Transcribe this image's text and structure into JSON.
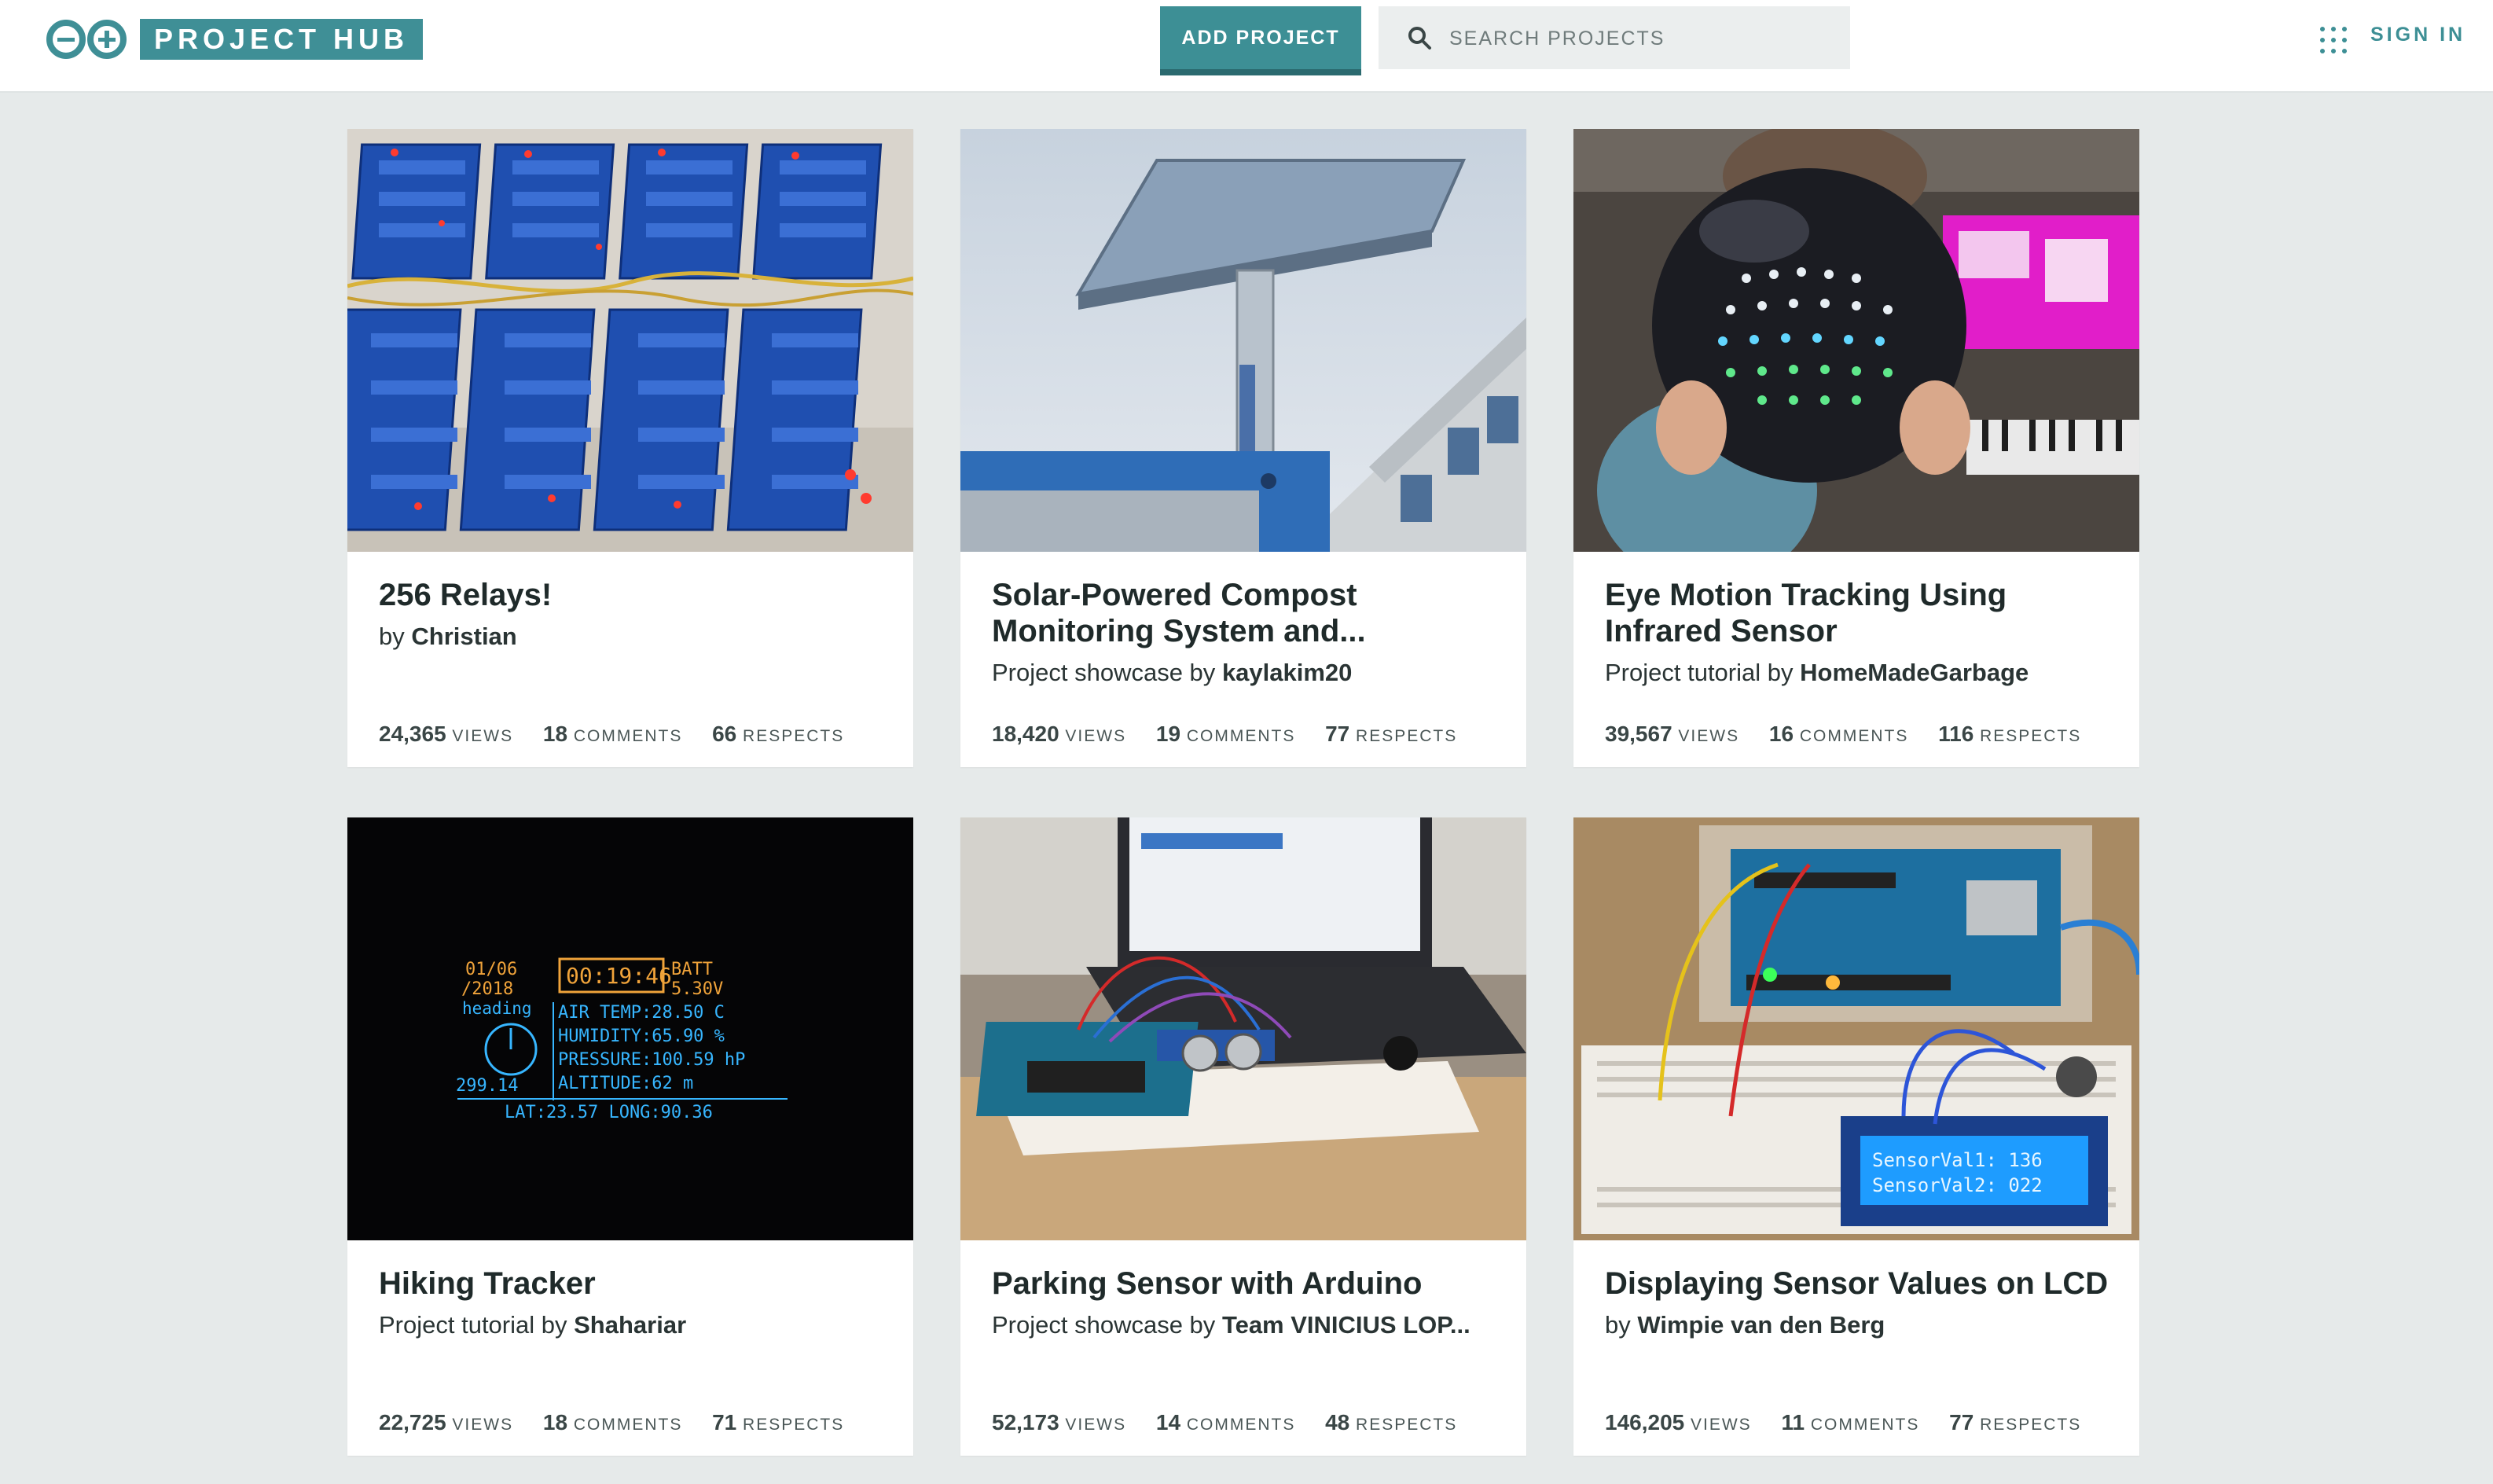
{
  "header": {
    "logo_text": "PROJECT HUB",
    "add_project": "ADD PROJECT",
    "search_placeholder": "SEARCH PROJECTS",
    "sign_in": "SIGN IN"
  },
  "labels": {
    "views": "VIEWS",
    "comments": "COMMENTS",
    "respects": "RESPECTS"
  },
  "colors": {
    "accent": "#3d8f95",
    "background": "#e6eaea"
  },
  "cards": [
    {
      "title": "256 Relays!",
      "prefix": "by",
      "author": "Christian",
      "views": "24,365",
      "comments": "18",
      "respects": "66"
    },
    {
      "title": "Solar-Powered Compost Monitoring System and...",
      "prefix": "Project showcase by",
      "author": "kaylakim20",
      "views": "18,420",
      "comments": "19",
      "respects": "77"
    },
    {
      "title": "Eye Motion Tracking Using Infrared Sensor",
      "prefix": "Project tutorial by",
      "author": "HomeMadeGarbage",
      "views": "39,567",
      "comments": "16",
      "respects": "116"
    },
    {
      "title": "Hiking Tracker",
      "prefix": "Project tutorial by",
      "author": "Shahariar",
      "views": "22,725",
      "comments": "18",
      "respects": "71"
    },
    {
      "title": "Parking Sensor with Arduino",
      "prefix": "Project showcase by",
      "author": "Team VINICIUS LOP...",
      "views": "52,173",
      "comments": "14",
      "respects": "48"
    },
    {
      "title": "Displaying Sensor Values on LCD",
      "prefix": "by",
      "author": "Wimpie van den Berg",
      "views": "146,205",
      "comments": "11",
      "respects": "77"
    }
  ],
  "oled": {
    "date1": "01/06",
    "date2": "/2018",
    "time": "00:19:46",
    "batt_label": "BATT",
    "batt": "5.30V",
    "heading_label": "heading",
    "heading": "299.14",
    "line1": "AIR TEMP:28.50  C",
    "line2": "HUMIDITY:65.90  %",
    "line3": "PRESSURE:100.59 hP",
    "line4": "ALTITUDE:62     m",
    "footer": "LAT:23.57 LONG:90.36"
  },
  "lcd": {
    "line1": "SensorVal1: 136",
    "line2": "SensorVal2: 022"
  }
}
